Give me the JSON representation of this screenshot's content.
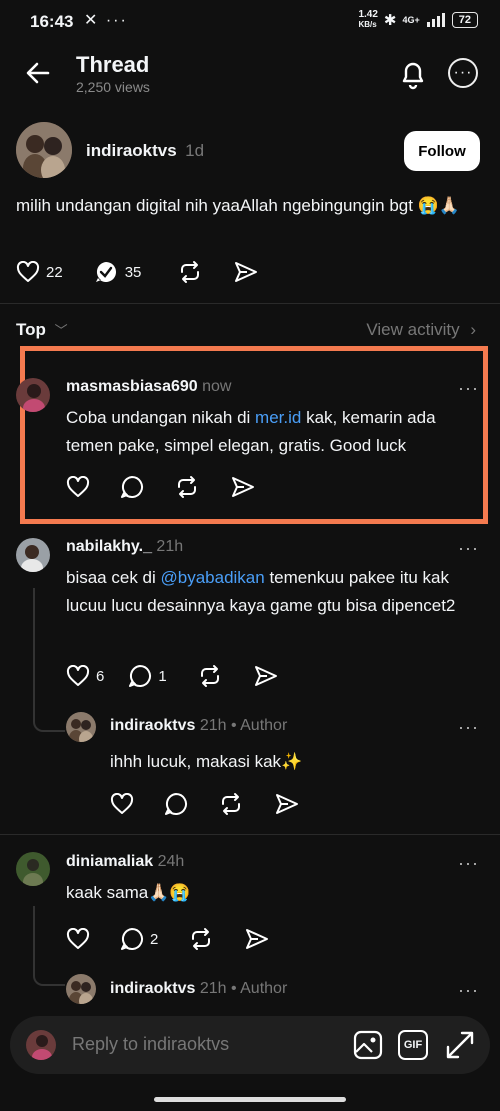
{
  "status_bar": {
    "time": "16:43",
    "left_icons": "✕ ···",
    "speed": "1.42",
    "speed_unit": "KB/s",
    "network": "4G+",
    "battery": "72"
  },
  "header": {
    "title": "Thread",
    "views": "2,250 views"
  },
  "post": {
    "username": "indiraoktvs",
    "time": "1d",
    "follow_label": "Follow",
    "text": "milih undangan digital nih yaaAllah ngebingungin bgt 😭🙏🏻",
    "likes": "22",
    "replies": "35"
  },
  "sort": {
    "label": "Top",
    "view_activity": "View activity"
  },
  "comments": [
    {
      "username": "masmasbiasa690",
      "time": "now",
      "text_before": "Coba undangan nikah di ",
      "link": "mer.id",
      "text_after": " kak, kemarin ada temen pake, simpel elegan, gratis. Good luck"
    },
    {
      "username": "nabilakhy._",
      "time": "21h",
      "text_before": "bisaa cek di ",
      "link": "@byabadikan",
      "text_after": " temenkuu pakee itu kak lucuu lucu desainnya kaya game gtu bisa dipencet2",
      "likes": "6",
      "replies": "1"
    },
    {
      "username": "indiraoktvs",
      "time": "21h",
      "author_tag": "• Author",
      "text": "ihhh lucuk, makasi kak✨"
    },
    {
      "username": "diniamaliak",
      "time": "24h",
      "text": "kaak sama🙏🏻😭",
      "replies": "2"
    },
    {
      "username": "indiraoktvs",
      "time": "21h",
      "author_tag": "• Author"
    }
  ],
  "reply_bar": {
    "placeholder": "Reply to indiraoktvs",
    "gif_label": "GIF"
  },
  "colors": {
    "background": "#101010",
    "highlight": "#f47a4f",
    "link": "#4a9ef7"
  }
}
